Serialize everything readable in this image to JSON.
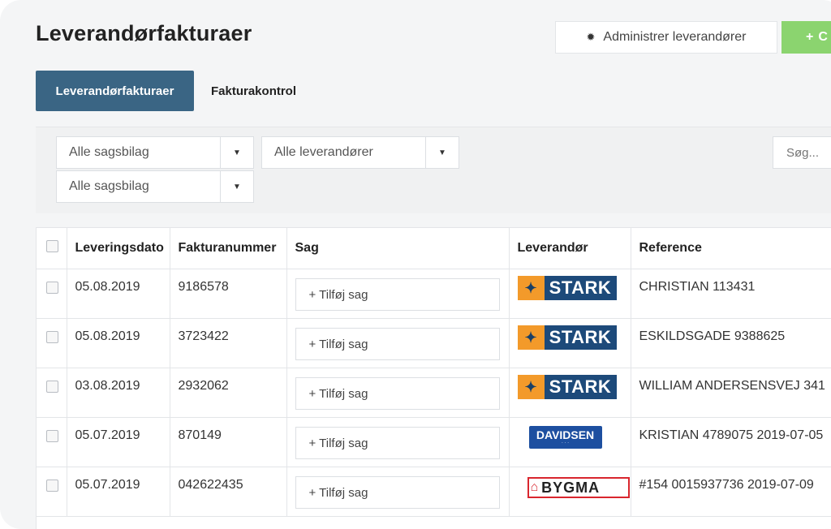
{
  "header": {
    "title": "Leverandørfakturaer",
    "admin_label": "Administrer leverandører",
    "admin_icon": "gear-icon",
    "create_label": "C",
    "create_icon": "plus-icon"
  },
  "tabs": [
    {
      "label": "Leverandørfakturaer",
      "active": true
    },
    {
      "label": "Fakturakontrol",
      "active": false
    }
  ],
  "filters": {
    "case_docs_1": "Alle sagsbilag",
    "suppliers": "Alle leverandører",
    "case_docs_2": "Alle sagsbilag",
    "search_placeholder": "Søg..."
  },
  "table": {
    "columns": [
      "Leveringsdato",
      "Fakturanummer",
      "Sag",
      "Leverandør",
      "Reference"
    ],
    "rows": [
      {
        "date": "05.08.2019",
        "invoice": "9186578",
        "case": "+ Tilføj sag",
        "supplier": "STARK",
        "reference": "CHRISTIAN 113431"
      },
      {
        "date": "05.08.2019",
        "invoice": "3723422",
        "case": "+ Tilføj sag",
        "supplier": "STARK",
        "reference": "ESKILDSGADE 9388625"
      },
      {
        "date": "03.08.2019",
        "invoice": "2932062",
        "case": "+ Tilføj sag",
        "supplier": "STARK",
        "reference": "WILLIAM ANDERSENSVEJ 341"
      },
      {
        "date": "05.07.2019",
        "invoice": "870149",
        "case": "+ Tilføj sag",
        "supplier": "DAVIDSEN",
        "reference": "KRISTIAN 4789075 2019-07-05"
      },
      {
        "date": "05.07.2019",
        "invoice": "042622435",
        "case": "+ Tilføj sag",
        "supplier": "BYGMA",
        "reference": "#154 0015937736 2019-07-09"
      }
    ]
  },
  "colors": {
    "tab_active": "#3a6584",
    "create_button": "#8bd46f",
    "stark_orange": "#f39a2a",
    "stark_blue": "#1d4a7a",
    "davidsen_blue": "#1d4fa0",
    "bygma_red": "#d9262e"
  }
}
